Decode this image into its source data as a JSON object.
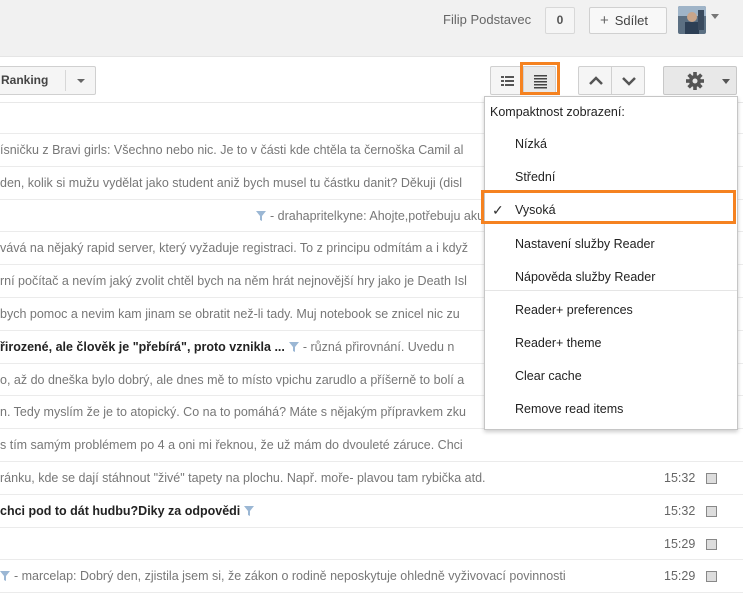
{
  "header": {
    "user_name": "Filip Podstavec",
    "count": "0",
    "share_label": "Sdílet"
  },
  "toolbar": {
    "sort_label": "Ranking",
    "icons": [
      "list-view-icon",
      "expanded-view-icon",
      "arrow-up-icon",
      "arrow-down-icon",
      "gear-icon"
    ]
  },
  "rows": [
    {
      "text": "ísničku z Bravi girls: Všechno nebo nic. Je to v části kde chtěla ta černoška Camil al",
      "time": ""
    },
    {
      "text": "den, kolik si mužu vydělat jako student aniž bych musel tu částku danit? Děkuji (disl",
      "time": ""
    },
    {
      "text": "- drahapritelkyne: Ahojte,potřebuju akutně poradit,chci překvapit přítele a nemůž",
      "time": ""
    },
    {
      "text": "vává na nějaký rapid server, který vyžaduje registraci. To z principu odmítám a i když",
      "time": ""
    },
    {
      "text": "rní počítač a nevím jaký zvolit chtěl bych na něm hrát nejnovější hry jako je Death Isl",
      "time": ""
    },
    {
      "text": "bych pomoc a nevim kam jinam se obratit než-li tady. Muj notebook se znicel nic zu",
      "time": ""
    },
    {
      "title": "řirozené, ale člověk je \"přebírá\", proto vznikla ...",
      "text": "- různá přirovnání. Uvedu n",
      "time": ""
    },
    {
      "text": "o, až do dneška bylo dobrý, ale dnes mě to místo vpichu zarudlo a příšerně to bolí a",
      "time": ""
    },
    {
      "text": "n. Tedy myslím že je to atopický. Co na to pomáhá? Máte s nějakým přípravkem zku",
      "time": ""
    },
    {
      "text": "s tím samým problémem po 4 a oni mi řeknou, že už mám do dvouleté záruce. Chci",
      "time": ""
    },
    {
      "text": "ránku, kde se dají stáhnout \"živé\" tapety na plochu. Např. moře- plavou tam rybička atd.",
      "time": "15:32"
    },
    {
      "title": "chci pod to dát hudbu?Diky za odpovědi",
      "text": "",
      "time": "15:32"
    },
    {
      "text": "",
      "time": "15:29"
    },
    {
      "text": "- marcelap: Dobrý den, zjistila jsem si, že zákon o rodině neposkytuje ohledně vyživovací povinnosti",
      "time": "15:29"
    }
  ],
  "menu": {
    "header": "Kompaktnost zobrazení:",
    "density_items": [
      "Nízká",
      "Střední",
      "Vysoká"
    ],
    "selected": "Vysoká",
    "items": [
      "Nastavení služby Reader",
      "Nápověda služby Reader"
    ],
    "plus_items": [
      "Reader+ preferences",
      "Reader+ theme",
      "Clear cache",
      "Remove read items"
    ]
  },
  "colors": {
    "highlight": "#f58220"
  }
}
